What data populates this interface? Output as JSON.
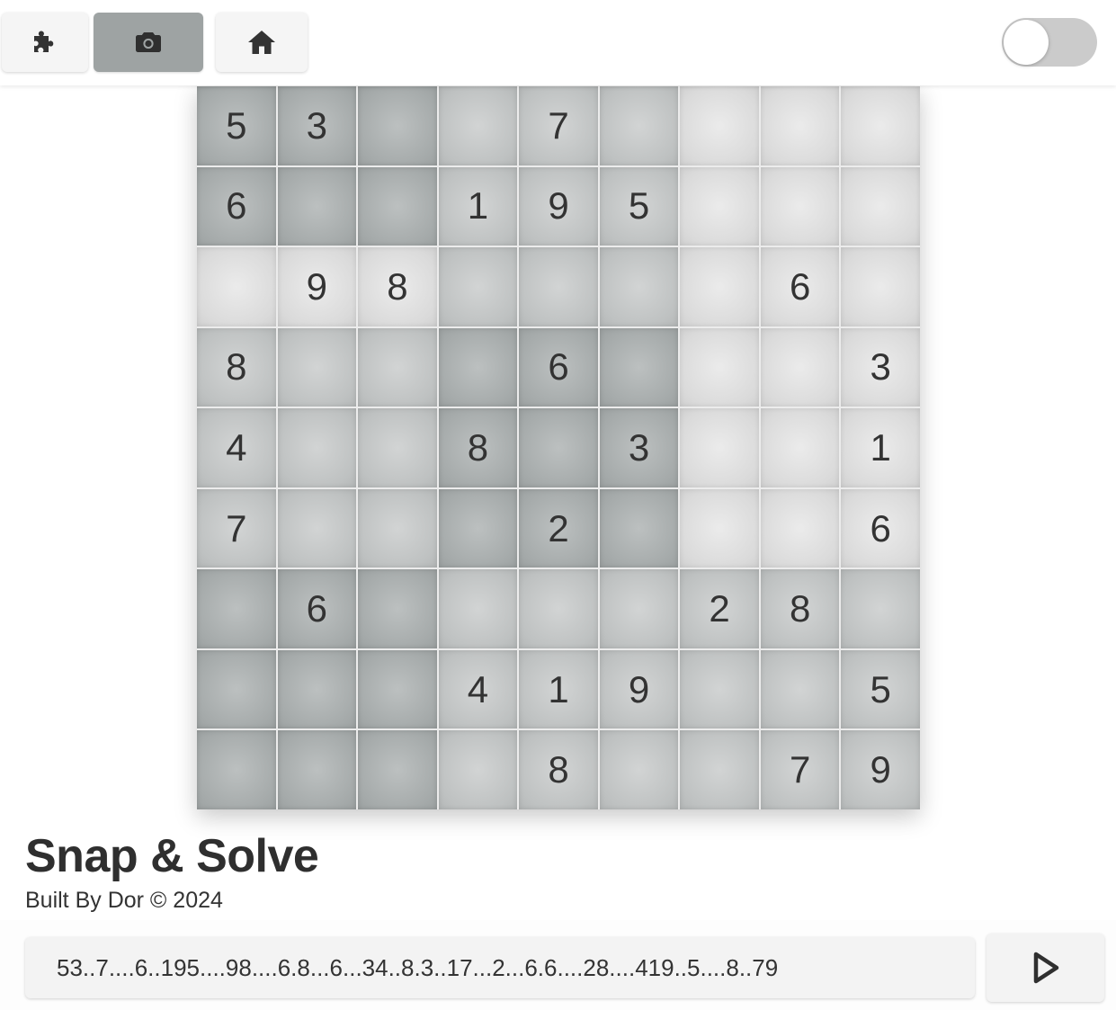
{
  "toolbar": {
    "buttons": [
      {
        "name": "puzzle",
        "icon": "puzzle-icon",
        "active": false
      },
      {
        "name": "camera",
        "icon": "camera-icon",
        "active": true
      },
      {
        "name": "home",
        "icon": "home-icon",
        "active": false
      }
    ],
    "theme_toggle": {
      "state": "off"
    }
  },
  "board": {
    "rows": [
      [
        "5",
        "3",
        "",
        "",
        "7",
        "",
        "",
        "",
        ""
      ],
      [
        "6",
        "",
        "",
        "1",
        "9",
        "5",
        "",
        "",
        ""
      ],
      [
        "",
        "9",
        "8",
        "",
        "",
        "",
        "",
        "6",
        ""
      ],
      [
        "8",
        "",
        "",
        "",
        "6",
        "",
        "",
        "",
        "3"
      ],
      [
        "4",
        "",
        "",
        "8",
        "",
        "3",
        "",
        "",
        "1"
      ],
      [
        "7",
        "",
        "",
        "",
        "2",
        "",
        "",
        "",
        "6"
      ],
      [
        "",
        "6",
        "",
        "",
        "",
        "",
        "2",
        "8",
        ""
      ],
      [
        "",
        "",
        "",
        "4",
        "1",
        "9",
        "",
        "",
        "5"
      ],
      [
        "",
        "",
        "",
        "",
        "8",
        "",
        "",
        "7",
        "9"
      ]
    ]
  },
  "app": {
    "title": "Snap & Solve",
    "subtitle": "Built By Dor © 2024"
  },
  "footer": {
    "puzzle_string": "53..7....6..195....98....6.8...6...34..8.3..17...2...6.6....28....419..5....8..79",
    "solve_icon": "play-icon"
  },
  "colors": {
    "active_button": "#9ea3a3",
    "toggle_track": "#cbcbcb",
    "text": "#333333"
  }
}
